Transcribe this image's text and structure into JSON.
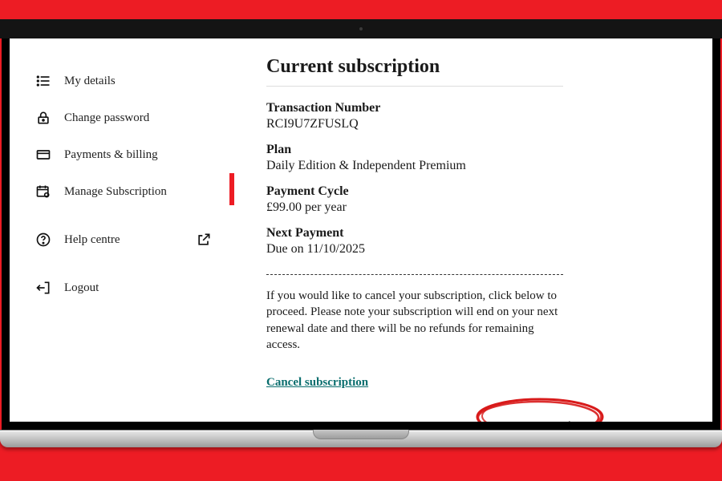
{
  "sidebar": {
    "items": [
      {
        "label": "My details"
      },
      {
        "label": "Change password"
      },
      {
        "label": "Payments & billing"
      },
      {
        "label": "Manage Subscription"
      },
      {
        "label": "Help centre"
      },
      {
        "label": "Logout"
      }
    ]
  },
  "main": {
    "title": "Current subscription",
    "fields": {
      "transaction": {
        "label": "Transaction Number",
        "value": "RCI9U7ZFUSLQ"
      },
      "plan": {
        "label": "Plan",
        "value": "Daily Edition & Independent Premium"
      },
      "cycle": {
        "label": "Payment Cycle",
        "value": "£99.00 per year"
      },
      "next": {
        "label": "Next Payment",
        "value": "Due on 11/10/2025"
      }
    },
    "cancel_blurb": "If you would like to cancel your subscription, click below to proceed. Please note your subscription will end on your next renewal date and there will be no refunds for remaining access.",
    "cancel_link": "Cancel subscription"
  },
  "colors": {
    "accent": "#ed1c24",
    "link_teal": "#0a6e6e"
  }
}
